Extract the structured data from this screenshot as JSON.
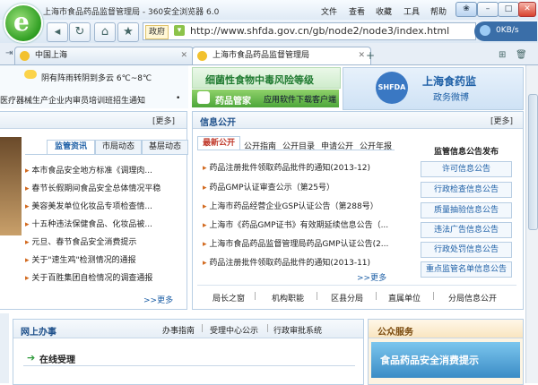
{
  "browser": {
    "window_title": "上海市食品药品监督管理局 - 360安全浏览器 6.0",
    "menu": [
      "文件",
      "查看",
      "收藏",
      "工具",
      "帮助"
    ],
    "zone_label": "政府",
    "url": "http://www.shfda.gov.cn/gb/node2/node3/index.html",
    "speed": "0KB/s",
    "tabs": [
      "中国上海",
      "上海市食品药品监督管理局"
    ],
    "new_tab": "+"
  },
  "page": {
    "weather": "阴有阵雨转阴到多云 6℃~8℃",
    "ticker": "医疗器械生产企业内审员培训班招生通知",
    "banner_left": "细菌性食物中毒风险等级",
    "banner_app": "药品管家",
    "banner_app_sub": "应用软件下载客户端",
    "weibo_logo": "SHFDA",
    "weibo_title": "上海食药监",
    "weibo_sub": "政务微博",
    "more": "[更多]",
    "news_tabs": [
      "监管资讯",
      "市局动态",
      "基层动态"
    ],
    "news_items": [
      "本市食品安全地方标准《调理肉...",
      "春节长假期间食品安全总体情况平稳",
      "美容美发单位化妆品专项检查情...",
      "十五种违法保健食品、化妆品被...",
      "元旦、春节食品安全消费提示",
      "关于\"速生鸡\"检测情况的通报",
      "关于百胜集团自检情况的调查通报"
    ],
    "news_more": ">>更多",
    "info_title": "信息公开",
    "info_tabs": [
      "最新公开",
      "公开指南",
      "公开目录",
      "申请公开",
      "公开年报"
    ],
    "info_items": [
      "药品注册批件领取药品批件的通知(2013-12)",
      "药品GMP认证审查公示（第25号）",
      "上海市药品经营企业GSP认证公告（第288号）",
      "上海市《药品GMP证书》有效期延续信息公告（...",
      "上海市食品药品监督管理局药品GMP认证公告(2...",
      "药品注册批件领取药品批件的通知(2013-11)"
    ],
    "info_more": ">>更多",
    "notice_title": "监管信息公告发布",
    "notice_buttons": [
      "许可信息公告",
      "行政检查信息公告",
      "质量抽验信息公告",
      "违法广告信息公告",
      "行政处罚信息公告",
      "重点监管名单信息公告"
    ],
    "info_links": [
      "局长之窗",
      "|",
      "机构职能",
      "|",
      "区县分局",
      "|",
      "直属单位",
      "|",
      "分局信息公开"
    ],
    "online_title": "网上办事",
    "online_links": [
      "办事指南",
      "|",
      "受理中心公示",
      "|",
      "行政审批系统"
    ],
    "online_sub": "在线受理",
    "public_title": "公众服务",
    "public_banner": "食品药品安全消费提示"
  }
}
